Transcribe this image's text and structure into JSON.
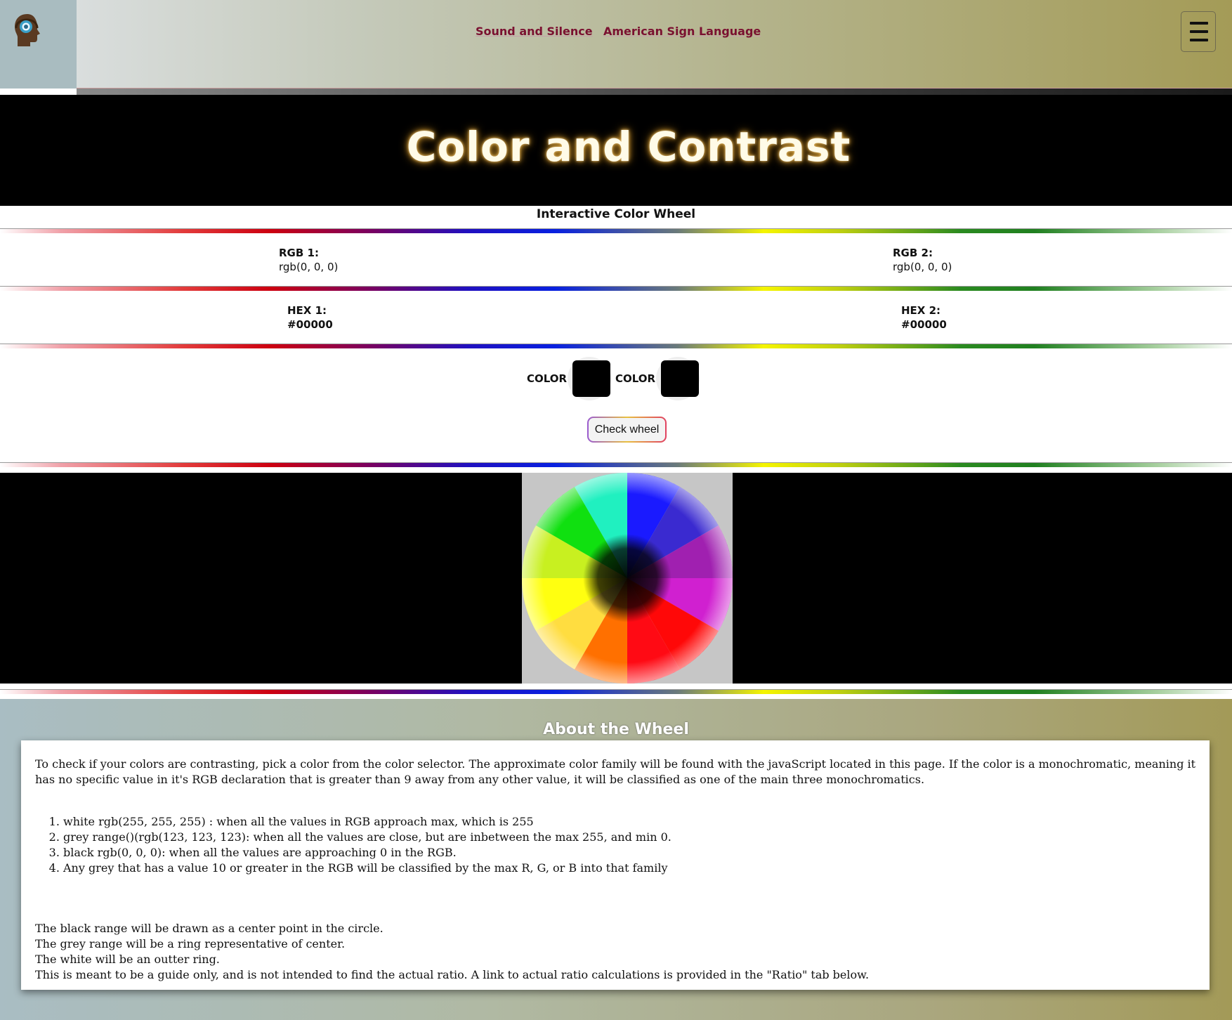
{
  "nav": {
    "links": [
      "Sound and Silence",
      "American Sign Language"
    ]
  },
  "title": "Color and Contrast",
  "subtitle": "Interactive Color Wheel",
  "rgb": {
    "label1": "RGB 1:",
    "value1": "rgb(0, 0, 0)",
    "label2": "RGB 2:",
    "value2": "rgb(0, 0, 0)"
  },
  "hex": {
    "label1": "HEX 1:",
    "value1": "#00000",
    "label2": "HEX 2:",
    "value2": "#00000"
  },
  "pickers": {
    "label1": "COLOR",
    "color1": "#000000",
    "label2": "COLOR",
    "color2": "#000000"
  },
  "check_button": "Check wheel",
  "wheel": {
    "segments": [
      "#1a1aff",
      "#3a2ad0",
      "#a020b0",
      "#d020d0",
      "#ff0808",
      "#ff0a14",
      "#ff7000",
      "#ffdd40",
      "#ffff10",
      "#c8f020",
      "#10e010",
      "#20f0c0"
    ],
    "center": "#000000"
  },
  "about": {
    "title": "About the Wheel",
    "intro": "To check if your colors are contrasting, pick a color from the color selector. The approximate color family will be found with the javaScript located in this page. If the color is a monochromatic, meaning it has no specific value in it's RGB declaration that is greater than 9 away from any other value, it will be classified as one of the main three monochromatics.",
    "list": [
      "white rgb(255, 255, 255) : when all the values in RGB approach max, which is 255",
      "grey range()(rgb(123, 123, 123): when all the values are close, but are inbetween the max 255, and min 0.",
      "black rgb(0, 0, 0): when all the values are approaching 0 in the RGB.",
      "Any grey that has a value 10 or greater in the RGB will be classified by the max R, G, or B into that family"
    ],
    "lines": [
      "The black range will be drawn as a center point in the circle.",
      "The grey range will be a ring representative of center.",
      "The white will be an outter ring.",
      "This is meant to be a guide only, and is not intended to find the actual ratio. A link to actual ratio calculations is provided in the \"Ratio\" tab below."
    ]
  }
}
